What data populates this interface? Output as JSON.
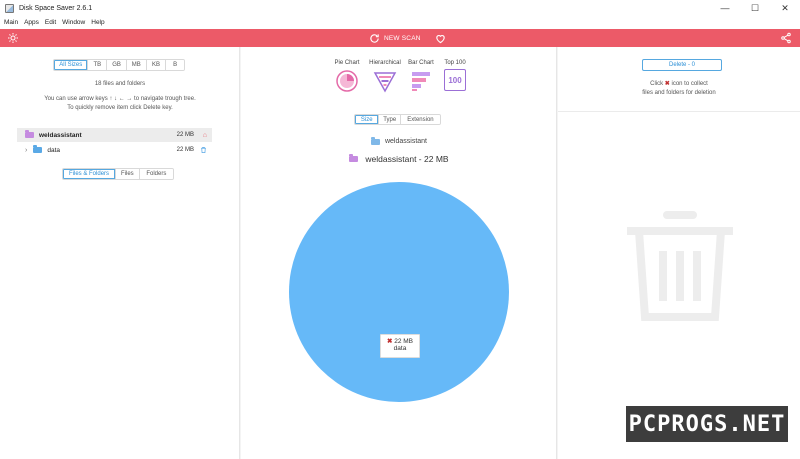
{
  "window": {
    "title": "Disk Space Saver 2.6.1",
    "minimize": "—",
    "maximize": "☐",
    "close": "✕"
  },
  "menu": [
    "Main",
    "Apps",
    "Edit",
    "Window",
    "Help"
  ],
  "toolbar": {
    "scan_label": "NEW SCAN"
  },
  "left": {
    "size_filters": [
      "All Sizes",
      "TB",
      "GB",
      "MB",
      "KB",
      "B"
    ],
    "count_text": "18 files and folders",
    "hint_line1": "You can use arrow keys ↑ ↓ ← → to navigate trough tree.",
    "hint_line2": "To quickly remove item click Delete key.",
    "tree": [
      {
        "name": "weldassistant",
        "size": "22 MB"
      },
      {
        "name": "data",
        "size": "22 MB"
      }
    ],
    "view_tabs": [
      "Files & Folders",
      "Files",
      "Folders"
    ]
  },
  "center": {
    "chart_types": [
      "Pie Chart",
      "Hierarchical",
      "Bar Chart",
      "Top 100"
    ],
    "top100_icon_text": "100",
    "group_tabs": [
      "Size",
      "Type",
      "Extension"
    ],
    "breadcrumb_small": "weldassistant",
    "breadcrumb_main": "weldassistant - 22 MB",
    "tooltip_size": "22 MB",
    "tooltip_name": "data"
  },
  "right": {
    "delete_label": "Delete - 0",
    "hint_prefix": "Click",
    "hint_suffix": "icon to collect",
    "hint_line2": "files and folders for deletion"
  },
  "watermark": "PCPROGS.NET",
  "colors": {
    "accent_red": "#ec5a68",
    "pie_blue": "#66b9f8",
    "folder_pink": "#c58be0",
    "folder_blue": "#5aa9e6",
    "active_blue": "#2b8fd6"
  },
  "chart_data": {
    "type": "pie",
    "categories": [
      "data"
    ],
    "values": [
      22
    ],
    "unit": "MB"
  }
}
